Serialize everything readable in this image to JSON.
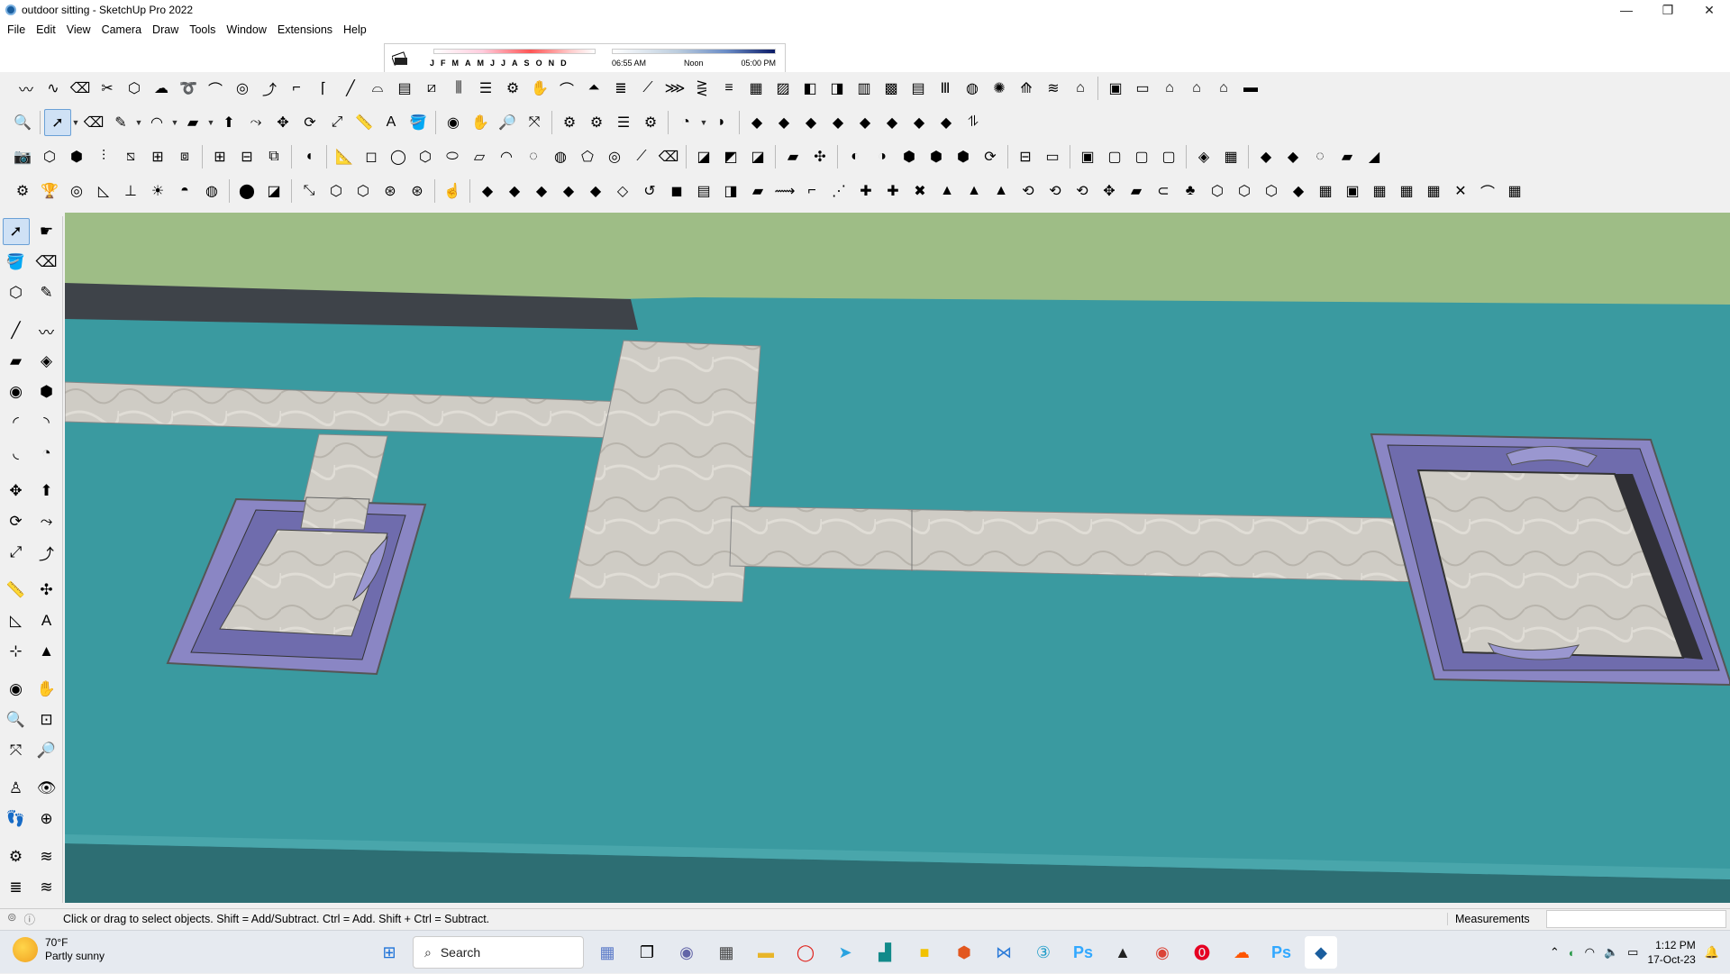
{
  "window": {
    "title": "outdoor sitting - SketchUp Pro 2022",
    "minimize": "—",
    "maximize": "❐",
    "close": "✕"
  },
  "menu": [
    "File",
    "Edit",
    "View",
    "Camera",
    "Draw",
    "Tools",
    "Window",
    "Extensions",
    "Help"
  ],
  "shadows": {
    "months": [
      "J",
      "F",
      "M",
      "A",
      "M",
      "J",
      "J",
      "A",
      "S",
      "O",
      "N",
      "D"
    ],
    "time_start": "06:55 AM",
    "time_mid": "Noon",
    "time_end": "05:00 PM"
  },
  "statusbar": {
    "message": "Click or drag to select objects. Shift = Add/Subtract. Ctrl = Add. Shift + Ctrl = Subtract.",
    "measurements_label": "Measurements",
    "measurements_value": ""
  },
  "taskbar": {
    "weather_temp": "70°F",
    "weather_desc": "Partly sunny",
    "search_label": "Search",
    "time": "1:12 PM",
    "date": "17-Oct-23"
  },
  "colors": {
    "sky": "#9ebd86",
    "ground": "#3a9aa0",
    "marble": "#cfccc5",
    "border_purple": "#8a86c4",
    "wall_dark": "#3e4349"
  }
}
